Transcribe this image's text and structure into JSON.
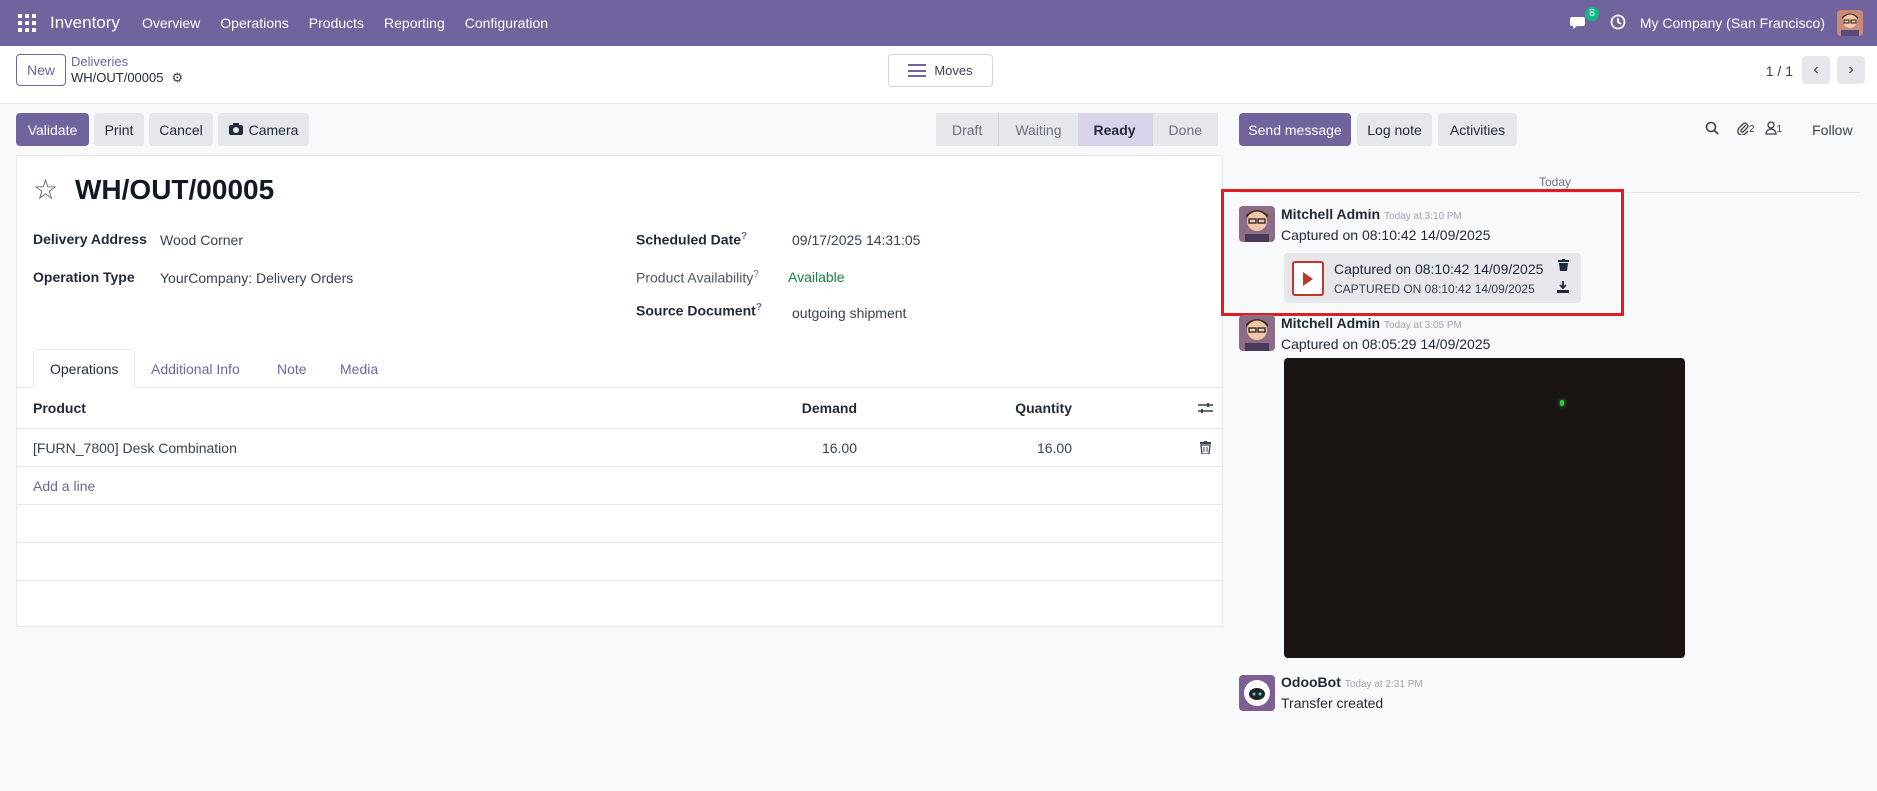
{
  "topbar": {
    "app_name": "Inventory",
    "menu": [
      "Overview",
      "Operations",
      "Products",
      "Reporting",
      "Configuration"
    ],
    "chat_badge": "8",
    "company": "My Company (San Francisco)"
  },
  "control": {
    "new_label": "New",
    "breadcrumb_parent": "Deliveries",
    "breadcrumb_current": "WH/OUT/00005",
    "moves_label": "Moves",
    "pager": "1 / 1"
  },
  "actions": {
    "validate": "Validate",
    "print": "Print",
    "cancel": "Cancel",
    "camera": "Camera"
  },
  "status": {
    "stages": [
      "Draft",
      "Waiting",
      "Ready",
      "Done"
    ],
    "active": "Ready"
  },
  "form": {
    "title": "WH/OUT/00005",
    "delivery_address_label": "Delivery Address",
    "delivery_address": "Wood Corner",
    "operation_type_label": "Operation Type",
    "operation_type": "YourCompany: Delivery Orders",
    "scheduled_date_label": "Scheduled Date",
    "scheduled_date": "09/17/2025 14:31:05",
    "availability_label": "Product Availability",
    "availability": "Available",
    "source_document_label": "Source Document",
    "source_document": "outgoing shipment",
    "help_mark": "?"
  },
  "tabs": [
    "Operations",
    "Additional Info",
    "Note",
    "Media"
  ],
  "table": {
    "headers": [
      "Product",
      "Demand",
      "Quantity"
    ],
    "rows": [
      {
        "product": "[FURN_7800] Desk Combination",
        "demand": "16.00",
        "quantity": "16.00"
      }
    ],
    "add_line": "Add a line"
  },
  "chatter": {
    "send_message": "Send message",
    "log_note": "Log note",
    "activities": "Activities",
    "attachments_count": "2",
    "followers_count": "1",
    "follow": "Follow",
    "day": "Today",
    "messages": [
      {
        "author": "Mitchell Admin",
        "time": "Today at 3:10 PM",
        "body": "Captured on 08:10:42 14/09/2025",
        "attachment_name": "Captured on 08:10:42 14/09/2025",
        "attachment_ext": "CAPTURED ON 08:10:42 14/09/2025"
      },
      {
        "author": "Mitchell Admin",
        "time": "Today at 3:05 PM",
        "body": "Captured on 08:05:29 14/09/2025"
      },
      {
        "author": "OdooBot",
        "time": "Today at 2:31 PM",
        "body": "Transfer created"
      }
    ]
  },
  "colors": {
    "brand": "#71639e",
    "highlight": "#e11d24",
    "available": "#16803c"
  }
}
